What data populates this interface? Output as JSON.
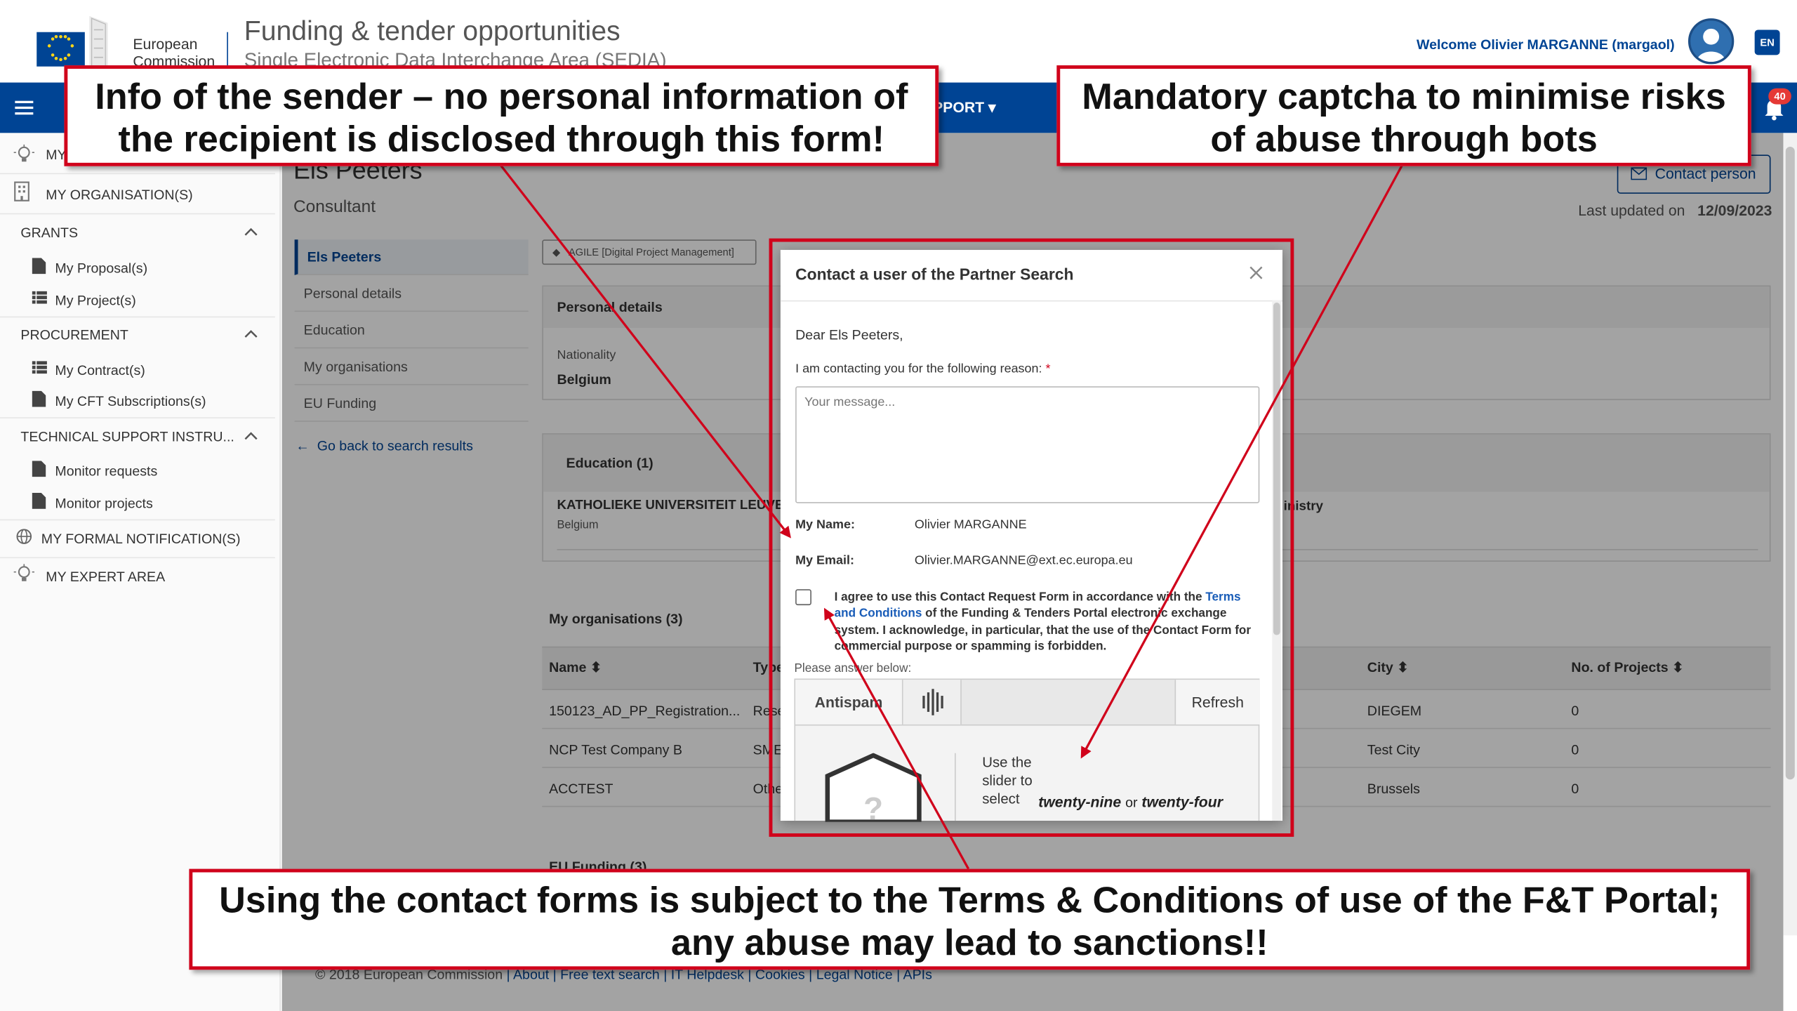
{
  "header": {
    "brand_line1": "European",
    "brand_line2": "Commission",
    "title": "Funding & tender opportunities",
    "subtitle": "Single Electronic Data Interchange Area (SEDIA)",
    "welcome": "Welcome Olivier MARGANNE (margaol)",
    "lang": "EN",
    "brand_color": "#004494"
  },
  "nav": {
    "support_label": "PPORT ▾",
    "notification_count": "40"
  },
  "sidebar": {
    "top1": "MY",
    "my_organisations": "MY ORGANISATION(S)",
    "grants": "GRANTS",
    "my_proposals": "My Proposal(s)",
    "my_projects": "My Project(s)",
    "procurement": "PROCUREMENT",
    "my_contracts": "My Contract(s)",
    "my_cft": "My CFT Subscriptions(s)",
    "tech_support": "TECHNICAL SUPPORT INSTRU...",
    "monitor_requests": "Monitor requests",
    "monitor_projects": "Monitor projects",
    "formal_notifications": "MY FORMAL NOTIFICATION(S)",
    "expert_area": "MY EXPERT AREA"
  },
  "profile": {
    "name": "Els Peeters",
    "role": "Consultant",
    "contact_button": "Contact person",
    "last_updated_label": "Last updated on",
    "last_updated_value": "12/09/2023",
    "tag": "AGILE [Digital Project Management]",
    "left_nav": [
      "Els Peeters",
      "Personal details",
      "Education",
      "My organisations",
      "EU Funding"
    ],
    "back_link": "Go back to search results"
  },
  "personal_details": {
    "heading": "Personal details",
    "nationality_label": "Nationality",
    "nationality_value": "Belgium"
  },
  "education": {
    "heading": "Education (1)",
    "institution": "KATHOLIEKE UNIVERSITEIT LEUVEN",
    "country": "Belgium",
    "field_fragment": "inistry"
  },
  "organisations": {
    "heading": "My organisations (3)",
    "columns": [
      "Name",
      "Type",
      "City",
      "No. of Projects"
    ],
    "rows": [
      {
        "name": "150123_AD_PP_Registration...",
        "type": "Rese",
        "city": "DIEGEM",
        "projects": "0"
      },
      {
        "name": "NCP Test Company B",
        "type": "SME",
        "city": "Test City",
        "projects": "0"
      },
      {
        "name": "ACCTEST",
        "type": "Othe",
        "city": "Brussels",
        "projects": "0"
      }
    ]
  },
  "eu_funding": {
    "heading": "EU Funding (3)"
  },
  "footer": {
    "copyright": "© 2018 European Commission",
    "links": [
      "About",
      "Free text search",
      "IT Helpdesk",
      "Cookies",
      "Legal Notice",
      "APIs"
    ]
  },
  "modal": {
    "title": "Contact a user of the Partner Search",
    "greeting": "Dear Els Peeters,",
    "reason_label": "I am contacting you for the following reason:",
    "required_mark": "*",
    "message_placeholder": "Your message...",
    "name_label": "My Name:",
    "name_value": "Olivier MARGANNE",
    "email_label": "My Email:",
    "email_value": "Olivier.MARGANNE@ext.ec.europa.eu",
    "agree_pre": "I agree to use this Contact Request Form in accordance with the",
    "agree_link": "Terms and Conditions",
    "agree_post": "of the Funding & Tenders Portal electronic exchange system. I acknowledge, in particular, that the use of the Contact Form for commercial purpose or spamming is forbidden.",
    "answer_label": "Please answer below:",
    "captcha_tab": "Antispam",
    "captcha_refresh": "Refresh",
    "captcha_instruction": "Use the slider to select",
    "captcha_word1": "twenty-nine",
    "captcha_or": "or",
    "captcha_word2": "twenty-four"
  },
  "callouts": {
    "left": "Info of the sender – no personal information of the recipient is disclosed through this form!",
    "right": "Mandatory captcha to minimise risks of abuse through bots",
    "bottom": "Using the contact forms is subject to the Terms & Conditions of use of the F&T Portal; any abuse may lead to sanctions!!",
    "color": "#d0021b"
  }
}
